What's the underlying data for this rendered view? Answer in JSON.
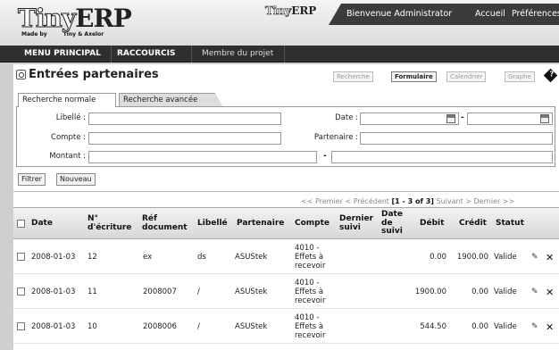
{
  "header": {
    "logo": {
      "word_tiny": "Tiny",
      "word_erp": "ERP",
      "made_by": "Made by",
      "company": "Tiny & Axelor"
    },
    "mini_logo": {
      "word_tiny": "Tiny",
      "word_erp": "ERP"
    },
    "welcome": "Bienvenue Administrator",
    "home": "Accueil",
    "preferences": "Préférences"
  },
  "menu": {
    "main": "MENU PRINCIPAL",
    "shortcuts": "RACCOURCIS",
    "project_member": "Membre du projet"
  },
  "page": {
    "title": "Entrées partenaires",
    "views": {
      "search": "Recherche",
      "form": "Formulaire",
      "calendar": "Calendrier",
      "graph": "Graphe"
    },
    "help_glyph": "?"
  },
  "search": {
    "tabs": {
      "normal": "Recherche normale",
      "advanced": "Recherche avancée"
    },
    "fields": {
      "libelle": "Libellé :",
      "compte": "Compte :",
      "montant": "Montant :",
      "date": "Date :",
      "partenaire": "Partenaire :"
    },
    "range_sep": "-"
  },
  "actions": {
    "filter": "Filtrer",
    "new": "Nouveau"
  },
  "pager": {
    "first": "<< Premier",
    "prev": "< Précédent",
    "range": "[1 - 3 of 3]",
    "next": "Suivant >",
    "last": "Dernier >>"
  },
  "table": {
    "headers": {
      "date": "Date",
      "num": "N° d'écriture",
      "ref": "Réf document",
      "libelle": "Libellé",
      "partenaire": "Partenaire",
      "compte": "Compte",
      "dernier": "Dernier suivi",
      "date_suivi": "Date de suivi",
      "debit": "Débit",
      "credit": "Crédit",
      "statut": "Statut"
    },
    "rows": [
      {
        "date": "2008-01-03",
        "num": "12",
        "ref": "ex",
        "libelle": "ds",
        "partenaire": "ASUStek",
        "compte_1": "4010 -",
        "compte_2": "Effets à",
        "compte_3": "recevoir",
        "debit": "0.00",
        "credit": "1900.00",
        "statut": "Valide"
      },
      {
        "date": "2008-01-03",
        "num": "11",
        "ref": "2008007",
        "libelle": "/",
        "partenaire": "ASUStek",
        "compte_1": "4010 -",
        "compte_2": "Effets à",
        "compte_3": "recevoir",
        "debit": "1900.00",
        "credit": "0.00",
        "statut": "Valide"
      },
      {
        "date": "2008-01-03",
        "num": "10",
        "ref": "2008006",
        "libelle": "/",
        "partenaire": "ASUStek",
        "compte_1": "4010 -",
        "compte_2": "Effets à",
        "compte_3": "recevoir",
        "debit": "544.50",
        "credit": "0.00",
        "statut": "Valide"
      }
    ],
    "edit_glyph": "✎",
    "delete_glyph": "✕"
  }
}
